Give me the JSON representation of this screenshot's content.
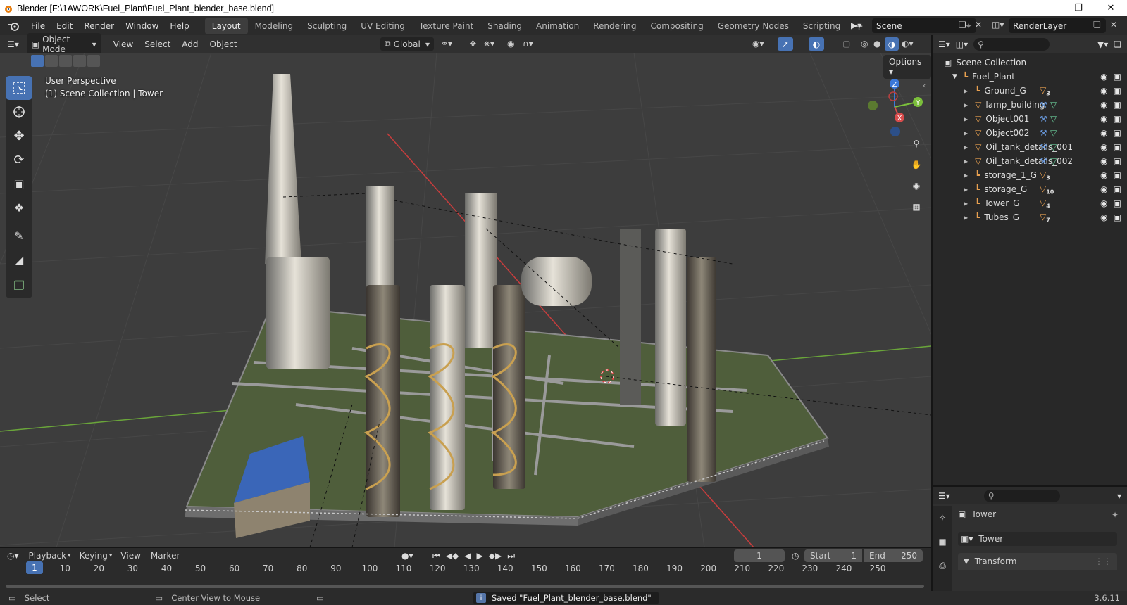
{
  "window": {
    "title": "Blender [F:\\1AWORK\\Fuel_Plant\\Fuel_Plant_blender_base.blend]",
    "min_icon": "minimize-icon",
    "max_icon": "restore-icon",
    "close_icon": "close-icon"
  },
  "menu": [
    "File",
    "Edit",
    "Render",
    "Window",
    "Help"
  ],
  "workspaces": [
    {
      "label": "Layout",
      "active": true
    },
    {
      "label": "Modeling",
      "active": false
    },
    {
      "label": "Sculpting",
      "active": false
    },
    {
      "label": "UV Editing",
      "active": false
    },
    {
      "label": "Texture Paint",
      "active": false
    },
    {
      "label": "Shading",
      "active": false
    },
    {
      "label": "Animation",
      "active": false
    },
    {
      "label": "Rendering",
      "active": false
    },
    {
      "label": "Compositing",
      "active": false
    },
    {
      "label": "Geometry Nodes",
      "active": false
    },
    {
      "label": "Scripting",
      "active": false
    }
  ],
  "scene": {
    "name": "Scene",
    "render_layer": "RenderLayer"
  },
  "viewport_header": {
    "mode": "Object Mode",
    "menus": [
      "View",
      "Select",
      "Add",
      "Object"
    ],
    "transform_orientation": "Global",
    "options_label": "Options"
  },
  "viewport": {
    "perspective_label": "User Perspective",
    "collection_label": "(1) Scene Collection | Tower",
    "gizmo_axes": [
      "Z",
      "Y",
      "X"
    ]
  },
  "outliner": {
    "root": "Scene Collection",
    "collection": "Fuel_Plant",
    "items": [
      {
        "name": "Ground_G",
        "type": "empty",
        "badge": "3"
      },
      {
        "name": "lamp_building",
        "type": "mesh",
        "badge": ""
      },
      {
        "name": "Object001",
        "type": "mesh",
        "badge": ""
      },
      {
        "name": "Object002",
        "type": "mesh",
        "badge": ""
      },
      {
        "name": "Oil_tank_details_001",
        "type": "mesh",
        "badge": ""
      },
      {
        "name": "Oil_tank_details_002",
        "type": "mesh",
        "badge": ""
      },
      {
        "name": "storage_1_G",
        "type": "empty",
        "badge": "3"
      },
      {
        "name": "storage_G",
        "type": "empty",
        "badge": "10"
      },
      {
        "name": "Tower_G",
        "type": "empty",
        "badge": "4"
      },
      {
        "name": "Tubes_G",
        "type": "empty",
        "badge": "7"
      }
    ]
  },
  "properties": {
    "object_name": "Tower",
    "data_name": "Tower",
    "panel": "Transform"
  },
  "timeline": {
    "menus": [
      "Playback",
      "Keying",
      "View",
      "Marker"
    ],
    "current_frame": "1",
    "start_label": "Start",
    "start": "1",
    "end_label": "End",
    "end": "250",
    "ticks": [
      "10",
      "20",
      "30",
      "40",
      "50",
      "60",
      "70",
      "80",
      "90",
      "100",
      "110",
      "120",
      "130",
      "140",
      "150",
      "160",
      "170",
      "180",
      "190",
      "200",
      "210",
      "220",
      "230",
      "240",
      "250"
    ]
  },
  "statusbar": {
    "select": "Select",
    "center_view": "Center View to Mouse",
    "message": "Saved \"Fuel_Plant_blender_base.blend\"",
    "version": "3.6.11"
  },
  "colors": {
    "accent": "#4772b3",
    "grid": "#3d3d3d",
    "x_axis": "#c83d3d",
    "y_axis": "#6aa53a"
  }
}
